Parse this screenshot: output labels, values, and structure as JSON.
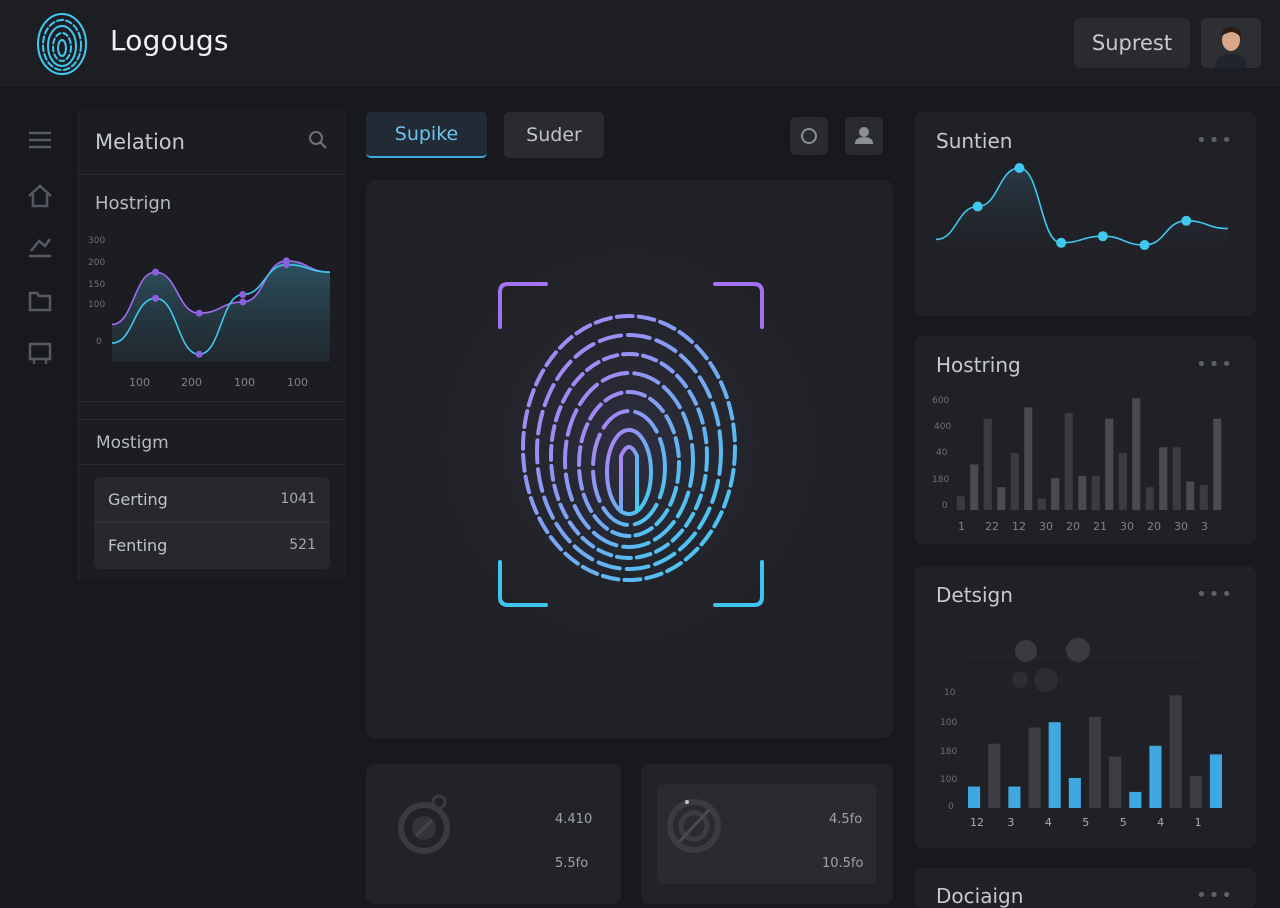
{
  "header": {
    "brand": "Logougs",
    "action_button": "Suprest"
  },
  "left": {
    "panel_title": "Melation",
    "chart_title": "Hostrign",
    "list_title": "Mostigm",
    "rows": [
      {
        "label": "Gerting",
        "value": "1041"
      },
      {
        "label": "Fenting",
        "value": "521"
      }
    ]
  },
  "tabs": [
    {
      "label": "Supike"
    },
    {
      "label": "Suder"
    }
  ],
  "minis": [
    {
      "top_value": "4.410",
      "bottom_value": "5.5fo"
    },
    {
      "top_value": "4.5fo",
      "bottom_value": "10.5fo"
    }
  ],
  "cards": {
    "line_title": "Suntien",
    "bars_title": "Hostring",
    "design_title": "Detsign",
    "bottom_title": "Dociaign",
    "more": "•••"
  },
  "colors": {
    "accent": "#3fa8df",
    "purple": "#a06cf0",
    "cyan": "#41c8f0"
  },
  "chart_data": [
    {
      "type": "line",
      "title": "Hostrign",
      "yticks": [
        "300",
        "200",
        "150",
        "100",
        "0"
      ],
      "xticks": [
        "100",
        "200",
        "100",
        "100"
      ],
      "series": [
        {
          "values": [
            90,
            230,
            120,
            150,
            260,
            230
          ]
        },
        {
          "values": [
            40,
            160,
            10,
            170,
            250,
            230
          ]
        }
      ]
    },
    {
      "type": "line",
      "title": "Suntien",
      "points": [
        0.25,
        0.55,
        0.9,
        0.22,
        0.28,
        0.2,
        0.42,
        0.35
      ]
    },
    {
      "type": "bar",
      "title": "Hostring",
      "yticks": [
        "600",
        "400",
        "40",
        "180",
        "0"
      ],
      "xticks": [
        "1",
        "22",
        "12",
        "30",
        "20",
        "21",
        "30",
        "20",
        "30",
        "3"
      ],
      "values": [
        12,
        40,
        80,
        20,
        50,
        90,
        10,
        28,
        85,
        30,
        30,
        80,
        50,
        98,
        20,
        55,
        55,
        25,
        22,
        80
      ]
    },
    {
      "type": "bar",
      "title": "Detsign",
      "yticks": [
        "10",
        "100",
        "180",
        "100",
        "0"
      ],
      "xticks": [
        "12",
        "3",
        "4",
        "5",
        "5",
        "4",
        "1"
      ],
      "values": [
        20,
        60,
        20,
        75,
        80,
        28,
        85,
        48,
        15,
        58,
        105,
        30,
        50
      ],
      "highlight": [
        0,
        2,
        4,
        5,
        8,
        9,
        12
      ]
    }
  ]
}
